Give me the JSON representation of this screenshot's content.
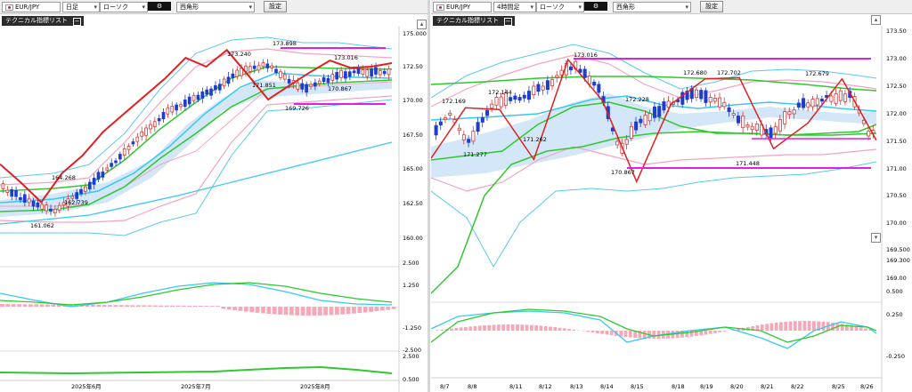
{
  "left": {
    "symbol": "EUR/JPY",
    "timeframe": "日足",
    "chart_kind": "ローソク",
    "style": "西角形",
    "settings_label": "設定",
    "tech_list_label": "テクニカル指標リスト",
    "price_axis": [
      "175.000",
      "172.50",
      "170.00",
      "167.50",
      "165.00",
      "162.50",
      "160.00"
    ],
    "macd_axis": [
      "2.500",
      "1.250",
      "-1.250",
      "-2.500"
    ],
    "rci_axis": [
      "2.500",
      "0.500"
    ],
    "price_labels": [
      "173.898",
      "173.240",
      "173.016",
      "171.851",
      "170.867",
      "169.726",
      "164.268",
      "162.739",
      "161.062"
    ],
    "x_labels": [
      "2025年6月",
      "2025年7月",
      "2025年8月"
    ]
  },
  "right": {
    "symbol": "EUR/JPY",
    "timeframe": "4時間足",
    "chart_kind": "ローソク",
    "style": "西角形",
    "settings_label": "設定",
    "tech_list_label": "テクニカル指標リスト",
    "price_axis": [
      "173.50",
      "173.00",
      "172.50",
      "172.00",
      "171.50",
      "171.00",
      "170.50",
      "170.00",
      "169.500",
      "169.300",
      "169.00",
      "0.500",
      "0.250",
      "-0.250"
    ],
    "price_labels": [
      "173.016",
      "172.680",
      "172.702",
      "172.679",
      "172.144",
      "172.228",
      "172.169",
      "171.262",
      "171.277",
      "170.867",
      "171.448"
    ],
    "x_labels": [
      "8/7",
      "8/8",
      "8/11",
      "8/12",
      "8/13",
      "8/14",
      "8/15",
      "8/18",
      "8/19",
      "8/20",
      "8/21",
      "8/22",
      "8/25",
      "8/26"
    ]
  },
  "colors": {
    "up_candle": "#d23a3a",
    "down_candle": "#1f3ccf",
    "bollinger_outer": "#5bc8f0",
    "bollinger_mid": "#f2a3c4",
    "moving_average": "#2ec92e",
    "kumo": "#c8e1f6",
    "support_resistance": "#e020e0",
    "macd_line": "#38c8f0",
    "signal_line": "#2ec92e",
    "histogram": "#f7a8b8",
    "trend_line": "#e02020"
  },
  "chart_data": [
    {
      "type": "line",
      "title": "",
      "subtitle": "",
      "xlabel": "",
      "ylabel": "",
      "ylim": [
        159.0,
        175.5
      ],
      "x": [
        "2025年6月",
        "2025年7月",
        "2025年8月"
      ],
      "series": [
        {
          "name": "",
          "values": [
            164.27,
            162.74,
            161.06,
            163.5,
            165.0,
            167.0,
            168.5,
            170.0,
            171.5,
            173.24,
            172.5,
            173.9,
            171.85,
            169.73,
            170.87,
            172.0,
            173.02,
            172.4,
            172.5,
            172.8
          ]
        }
      ],
      "annotations": [
        "173.898",
        "173.240",
        "173.016",
        "171.851",
        "170.867",
        "169.726",
        "164.268",
        "162.739",
        "161.062"
      ],
      "legend": "none"
    },
    {
      "type": "line",
      "title": "",
      "subtitle": "",
      "xlabel": "",
      "ylabel": "",
      "ylim": [
        168.9,
        173.6
      ],
      "x": [
        "8/7",
        "8/8",
        "8/11",
        "8/12",
        "8/13",
        "8/14",
        "8/15",
        "8/18",
        "8/19",
        "8/20",
        "8/21",
        "8/22",
        "8/25",
        "8/26"
      ],
      "series": [
        {
          "name": "",
          "values": [
            171.28,
            172.17,
            172.14,
            171.26,
            173.02,
            172.3,
            170.87,
            172.23,
            172.68,
            172.7,
            171.45,
            171.9,
            172.68,
            171.6
          ]
        }
      ],
      "annotations": [
        "173.016",
        "172.680",
        "172.702",
        "172.679",
        "172.144",
        "172.228",
        "172.169",
        "171.262",
        "171.277",
        "170.867",
        "171.448"
      ],
      "legend": "none"
    }
  ]
}
